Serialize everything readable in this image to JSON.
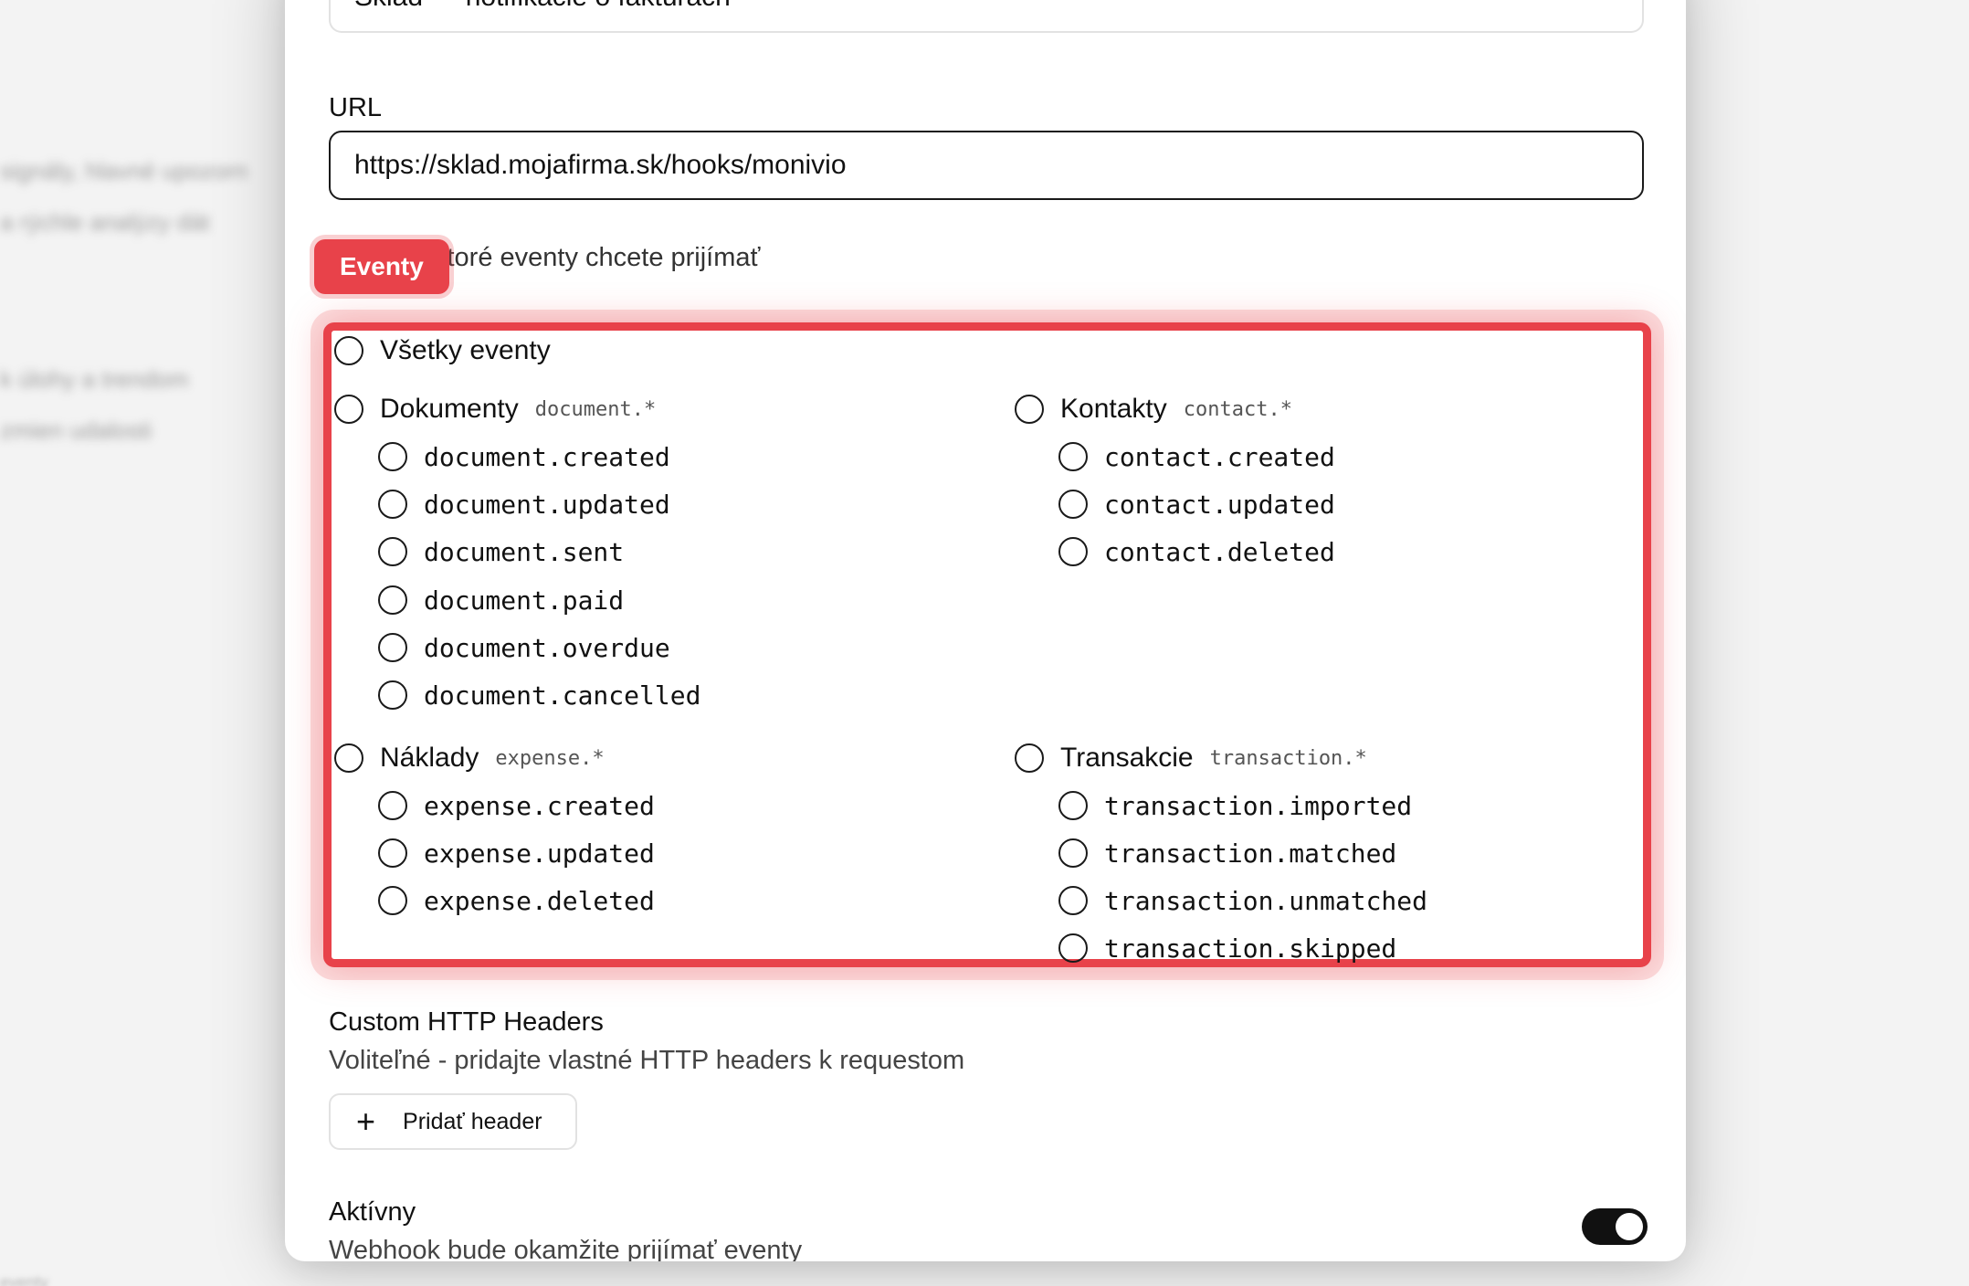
{
  "form": {
    "name_value": "Sklad — notifikácie o faktúrach",
    "url_label": "URL",
    "url_value": "https://sklad.mojafirma.sk/hooks/monivio",
    "events_tag": "Eventy",
    "events_hint": "Vyberte, ktoré eventy chcete prijímať",
    "all_events": "Všetky eventy",
    "groups": {
      "documents": {
        "label": "Dokumenty",
        "pattern": "document.*",
        "items": [
          "document.created",
          "document.updated",
          "document.sent",
          "document.paid",
          "document.overdue",
          "document.cancelled"
        ]
      },
      "contacts": {
        "label": "Kontakty",
        "pattern": "contact.*",
        "items": [
          "contact.created",
          "contact.updated",
          "contact.deleted"
        ]
      },
      "expenses": {
        "label": "Náklady",
        "pattern": "expense.*",
        "items": [
          "expense.created",
          "expense.updated",
          "expense.deleted"
        ]
      },
      "transactions": {
        "label": "Transakcie",
        "pattern": "transaction.*",
        "items": [
          "transaction.imported",
          "transaction.matched",
          "transaction.unmatched",
          "transaction.skipped"
        ]
      }
    },
    "headers_label": "Custom HTTP Headers",
    "headers_desc": "Voliteľné - pridajte vlastné HTTP headers k requestom",
    "add_header_label": "Pridať header",
    "active_label": "Aktívny",
    "active_desc": "Webhook bude okamžite prijímať eventy",
    "active_on": true
  },
  "background": {
    "line1": "signály, hlavné upozorn",
    "line2": "a rýchle analýzy dát",
    "line3": "k úlohy a trendom",
    "line4": "zmien udalosti",
    "footer": "eventy"
  },
  "colors": {
    "accent": "#e8424a",
    "toggle_on": "#111111"
  }
}
